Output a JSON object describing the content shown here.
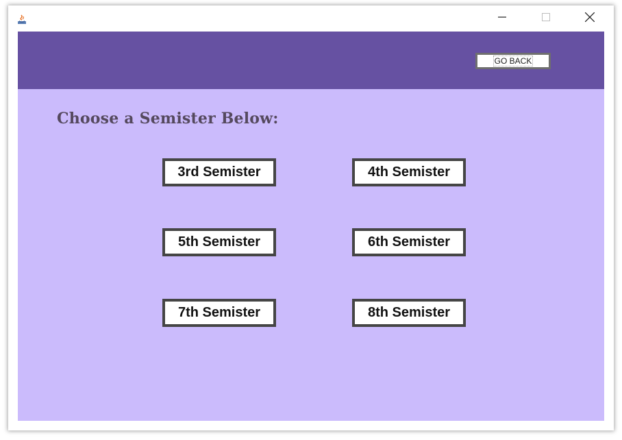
{
  "window": {
    "app_icon": "java-icon",
    "controls": {
      "minimize_icon": "minimize-icon",
      "maximize_icon": "maximize-icon",
      "close_icon": "close-icon"
    }
  },
  "header": {
    "go_back_label": "GO BACK",
    "background_color": "#6651a2"
  },
  "main": {
    "heading": "Choose a Semister Below:",
    "background_color": "#cbbbfc",
    "semesters": [
      "3rd Semister",
      "4th Semister",
      "5th Semister",
      "6th Semister",
      "7th Semister",
      "8th Semister"
    ]
  }
}
